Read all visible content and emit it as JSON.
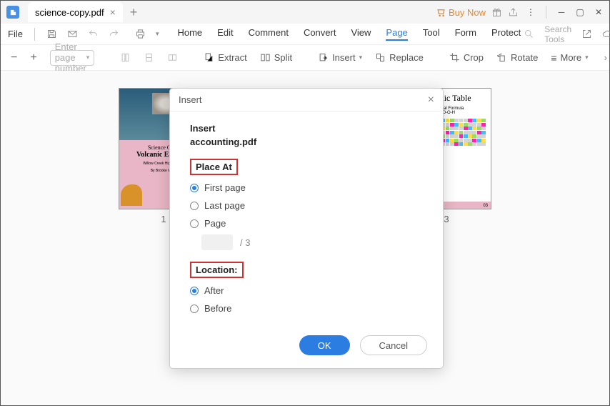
{
  "titlebar": {
    "tab_title": "science-copy.pdf",
    "buy_now": "Buy Now"
  },
  "menubar": {
    "file": "File",
    "tabs": [
      "Home",
      "Edit",
      "Comment",
      "Convert",
      "View",
      "Page",
      "Tool",
      "Form",
      "Protect"
    ],
    "active": "Page",
    "search_placeholder": "Search Tools"
  },
  "toolbar": {
    "page_placeholder": "Enter page number",
    "extract": "Extract",
    "split": "Split",
    "insert": "Insert",
    "replace": "Replace",
    "crop": "Crop",
    "rotate": "Rotate",
    "more": "More"
  },
  "thumbs": {
    "p1_num": "1",
    "p3_num": "3",
    "volcano": {
      "t1": "Science Class",
      "t2": "Volcanic Experim",
      "t3": "Willow Creek High School",
      "t4": "By Brooke Wells"
    },
    "periodic": {
      "title": "Periodic Table",
      "sub": "Chemical Formula",
      "form": "H-O-O-H",
      "pg": "03"
    }
  },
  "dialog": {
    "title": "Insert",
    "sec": "Insert",
    "file": "accounting.pdf",
    "place_at": "Place At",
    "first": "First page",
    "last": "Last page",
    "page": "Page",
    "total": "/  3",
    "location": "Location:",
    "after": "After",
    "before": "Before",
    "ok": "OK",
    "cancel": "Cancel"
  }
}
